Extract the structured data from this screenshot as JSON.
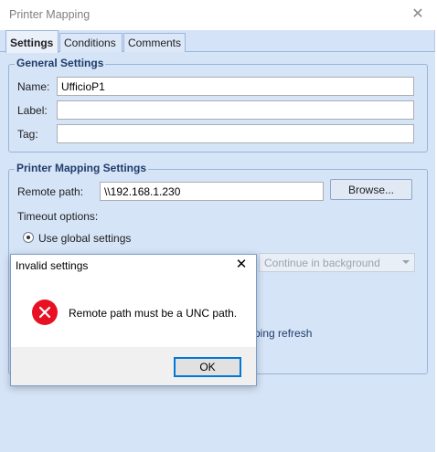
{
  "window": {
    "title": "Printer Mapping",
    "close_glyph": "✕"
  },
  "tabs": [
    {
      "label": "Settings",
      "active": true
    },
    {
      "label": "Conditions",
      "active": false
    },
    {
      "label": "Comments",
      "active": false
    }
  ],
  "general": {
    "title": "General Settings",
    "name_label": "Name:",
    "name_value": "UfficioP1",
    "label_label": "Label:",
    "label_value": "",
    "tag_label": "Tag:",
    "tag_value": ""
  },
  "mapping": {
    "title": "Printer Mapping Settings",
    "remote_path_label": "Remote path:",
    "remote_path_value": "\\\\192.168.1.230",
    "browse_label": "Browse...",
    "timeout_label": "Timeout options:",
    "use_global_label": "Use global settings",
    "use_global_selected": true,
    "continue_combo_value": "Continue in background",
    "partial_refresh_text": "ping refresh"
  },
  "dialog": {
    "title": "Invalid settings",
    "close_glyph": "✕",
    "message": "Remote path must be a UNC path.",
    "ok_label": "OK",
    "icon": "error-icon",
    "icon_color": "#e81123"
  },
  "colors": {
    "accent": "#0078d7",
    "group_title": "#1f3d6b",
    "window_bg": "#d6e4f7"
  }
}
